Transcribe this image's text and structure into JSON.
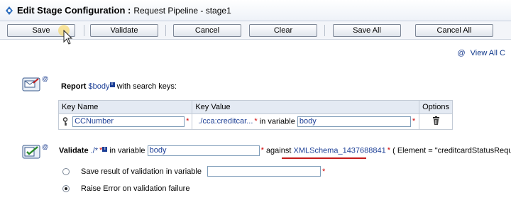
{
  "header": {
    "title": "Edit Stage Configuration :",
    "subtitle": "Request Pipeline - stage1"
  },
  "toolbar": {
    "save_label": "Save",
    "validate_label": "Validate",
    "cancel_label": "Cancel",
    "clear_label": "Clear",
    "save_all_label": "Save All",
    "cancel_all_label": "Cancel All"
  },
  "links": {
    "view_all": "View All C"
  },
  "report": {
    "label": "Report",
    "variable": "$body",
    "suffix": "with search keys:",
    "columns": [
      "Key Name",
      "Key Value",
      "Options"
    ],
    "row": {
      "key_name": "CCNumber",
      "key_value_xpath": "./cca:creditcar...",
      "in_variable_label": "in variable",
      "variable_value": "body"
    }
  },
  "validate": {
    "label": "Validate",
    "xpath": "./*",
    "in_variable_label": "in variable",
    "variable_value": "body",
    "against_label": "against",
    "schema": "XMLSchema_1437688841",
    "element_text": "( Element = \"creditcardStatusRequest\" )",
    "option_save_label": "Save result of validation in variable",
    "option_raise_label": "Raise Error on validation failure",
    "save_variable_value": "",
    "selected_option": "raise"
  },
  "marks": {
    "required": "*",
    "at_symbol": "@",
    "info_glyph": "i"
  },
  "colors": {
    "accent": "#1c3f96",
    "required": "#d00000",
    "underline": "#c41a1a"
  }
}
